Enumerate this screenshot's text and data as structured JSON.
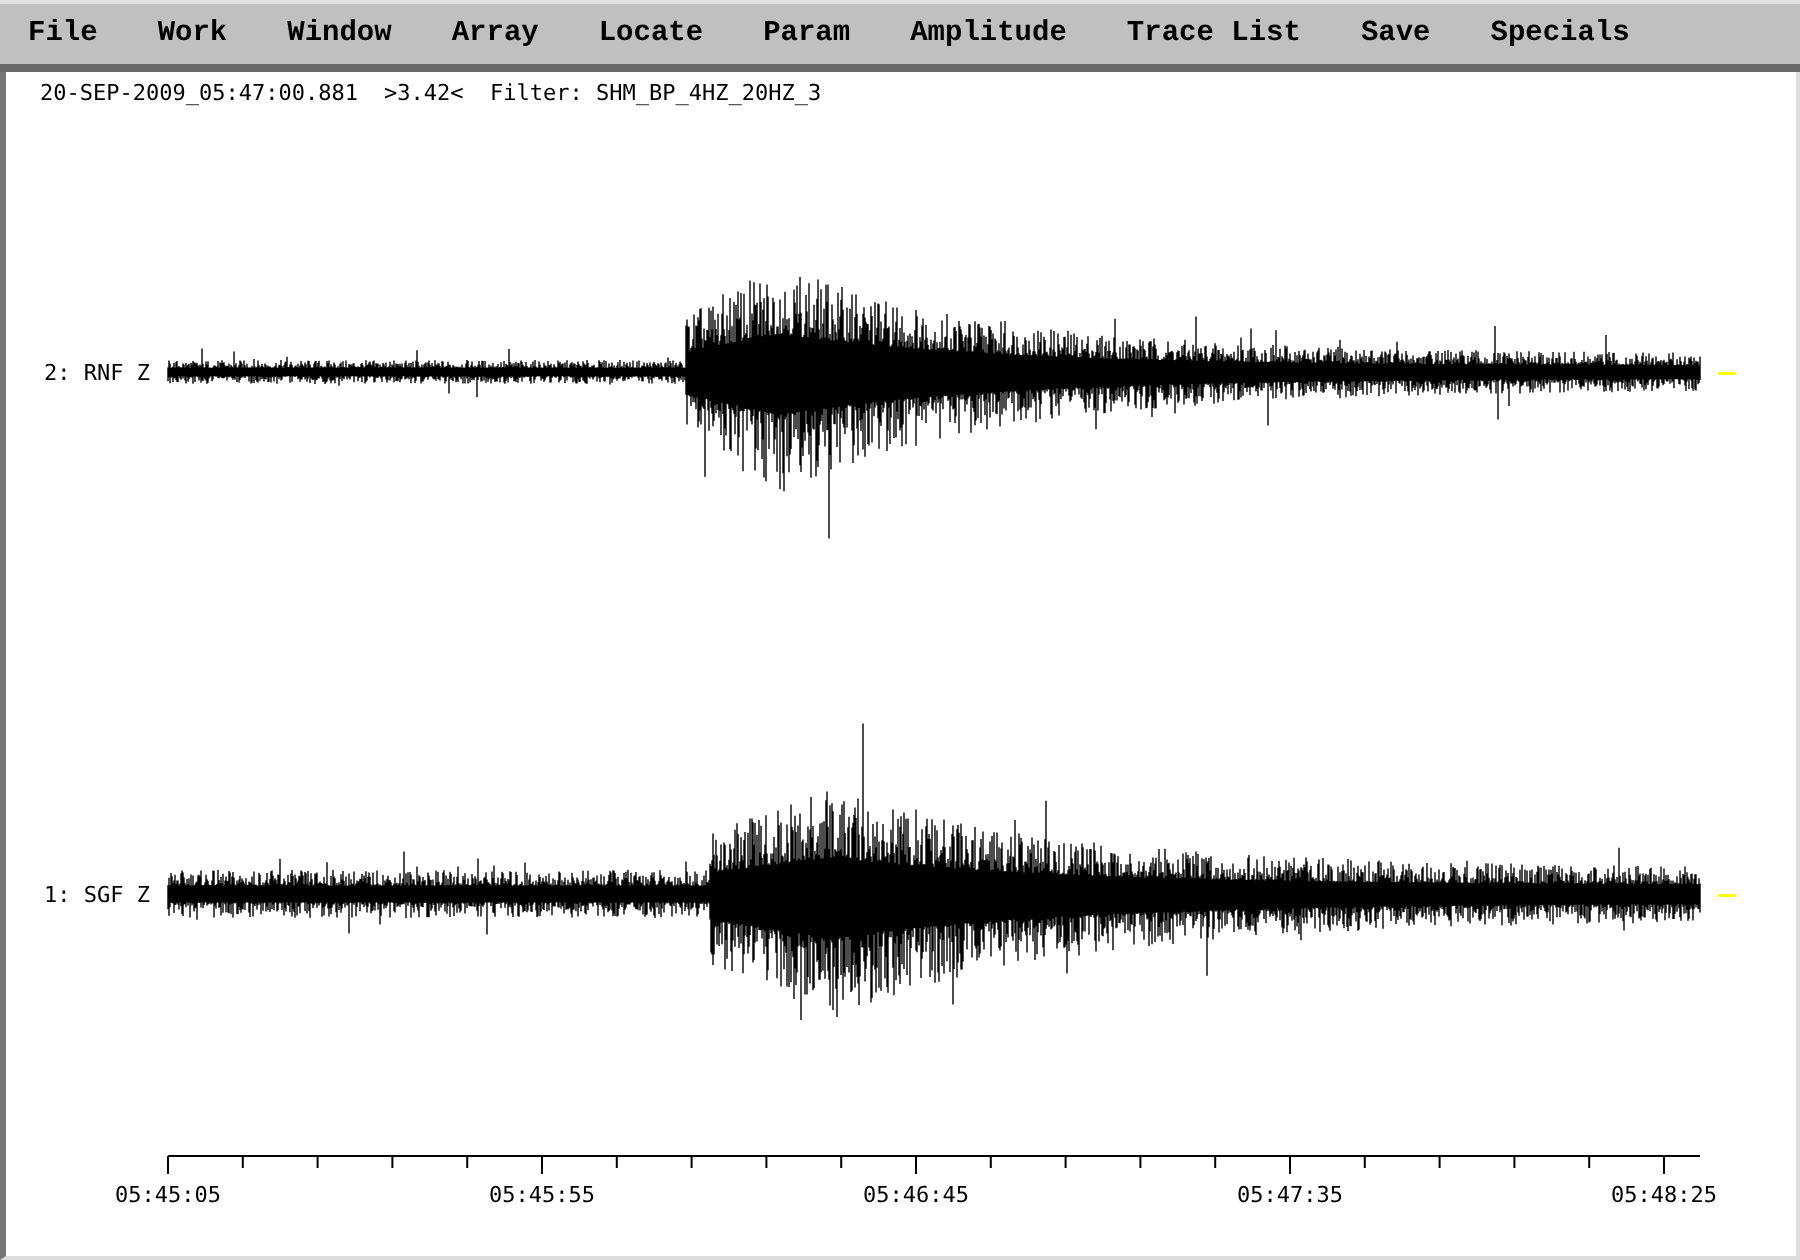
{
  "menu": [
    {
      "label": "File"
    },
    {
      "label": "Work"
    },
    {
      "label": "Window"
    },
    {
      "label": "Array"
    },
    {
      "label": "Locate"
    },
    {
      "label": "Param"
    },
    {
      "label": "Amplitude"
    },
    {
      "label": "Trace List"
    },
    {
      "label": "Save"
    },
    {
      "label": "Specials"
    }
  ],
  "header": {
    "time": "20-SEP-2009_05:47:00.881",
    "amplitude": ">3.42<",
    "filter": "Filter: SHM_BP_4HZ_20HZ_3"
  },
  "traces": [
    {
      "label": "2: RNF Z"
    },
    {
      "label": "1: SGF Z"
    }
  ],
  "time_axis": {
    "labels": [
      "05:45:05",
      "05:45:55",
      "05:46:45",
      "05:47:35",
      "05:48:25"
    ]
  }
}
